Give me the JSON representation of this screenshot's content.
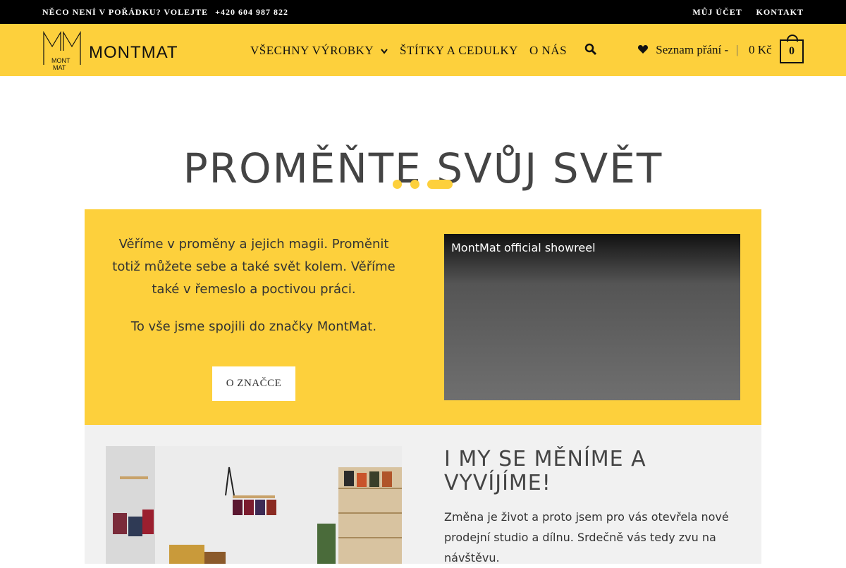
{
  "topbar": {
    "notice": "NĚCO NENÍ V POŘÁDKU? VOLEJTE",
    "phone": "+420 604 987 822",
    "account": "MŮJ ÚČET",
    "contact": "KONTAKT"
  },
  "header": {
    "logo_text": "MONTMAT",
    "logo_icon": "montmat-monogram-logo",
    "nav": {
      "all_products": "VŠECHNY VÝROBKY",
      "labels": "ŠTÍTKY A CEDULKY",
      "about": "O NÁS"
    },
    "wishlist": "Seznam přání -",
    "separator": "|",
    "cart_total": "0 Kč",
    "cart_count": "0"
  },
  "hero": {
    "title": "PROMĚŇTE SVŮJ SVĚT"
  },
  "intro": {
    "p1": "Věříme v proměny a jejich magii. Proměnit totiž můžete sebe a také svět kolem. Věříme také v řemeslo a poctivou práci.",
    "p2": "To vše jsme spojili do značky MontMat.",
    "button": "O ZNAČCE",
    "video_title": "MontMat official showreel"
  },
  "section2": {
    "title": "I MY SE MĚNÍME A VYVÍJÍME!",
    "text": "Změna je život a proto jsem pro vás otevřela nové prodejní studio a dílnu. Srdečně vás tedy zvu na návštěvu."
  },
  "colors": {
    "brand_yellow": "#fdd03c",
    "topbar": "#000000",
    "section_gray": "#f1f1f1"
  }
}
